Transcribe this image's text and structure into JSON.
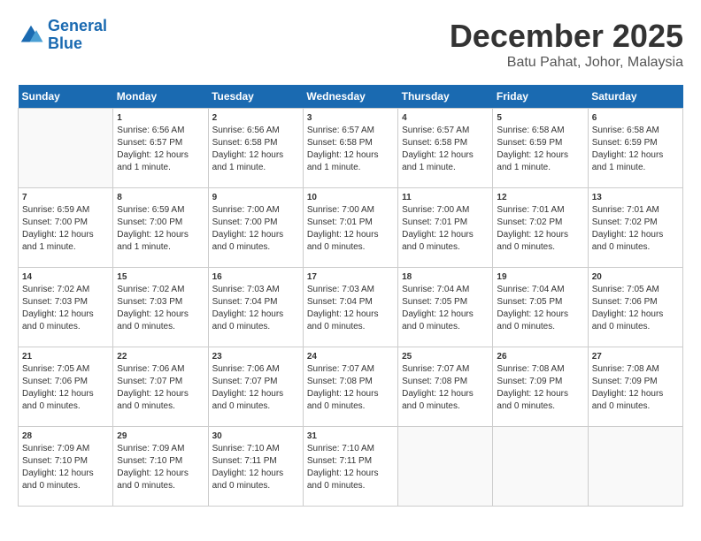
{
  "logo": {
    "line1": "General",
    "line2": "Blue"
  },
  "title": "December 2025",
  "location": "Batu Pahat, Johor, Malaysia",
  "days_of_week": [
    "Sunday",
    "Monday",
    "Tuesday",
    "Wednesday",
    "Thursday",
    "Friday",
    "Saturday"
  ],
  "weeks": [
    [
      {
        "day": "",
        "sunrise": "",
        "sunset": "",
        "daylight": ""
      },
      {
        "day": "1",
        "sunrise": "Sunrise: 6:56 AM",
        "sunset": "Sunset: 6:57 PM",
        "daylight": "Daylight: 12 hours and 1 minute."
      },
      {
        "day": "2",
        "sunrise": "Sunrise: 6:56 AM",
        "sunset": "Sunset: 6:58 PM",
        "daylight": "Daylight: 12 hours and 1 minute."
      },
      {
        "day": "3",
        "sunrise": "Sunrise: 6:57 AM",
        "sunset": "Sunset: 6:58 PM",
        "daylight": "Daylight: 12 hours and 1 minute."
      },
      {
        "day": "4",
        "sunrise": "Sunrise: 6:57 AM",
        "sunset": "Sunset: 6:58 PM",
        "daylight": "Daylight: 12 hours and 1 minute."
      },
      {
        "day": "5",
        "sunrise": "Sunrise: 6:58 AM",
        "sunset": "Sunset: 6:59 PM",
        "daylight": "Daylight: 12 hours and 1 minute."
      },
      {
        "day": "6",
        "sunrise": "Sunrise: 6:58 AM",
        "sunset": "Sunset: 6:59 PM",
        "daylight": "Daylight: 12 hours and 1 minute."
      }
    ],
    [
      {
        "day": "7",
        "sunrise": "Sunrise: 6:59 AM",
        "sunset": "Sunset: 7:00 PM",
        "daylight": "Daylight: 12 hours and 1 minute."
      },
      {
        "day": "8",
        "sunrise": "Sunrise: 6:59 AM",
        "sunset": "Sunset: 7:00 PM",
        "daylight": "Daylight: 12 hours and 1 minute."
      },
      {
        "day": "9",
        "sunrise": "Sunrise: 7:00 AM",
        "sunset": "Sunset: 7:00 PM",
        "daylight": "Daylight: 12 hours and 0 minutes."
      },
      {
        "day": "10",
        "sunrise": "Sunrise: 7:00 AM",
        "sunset": "Sunset: 7:01 PM",
        "daylight": "Daylight: 12 hours and 0 minutes."
      },
      {
        "day": "11",
        "sunrise": "Sunrise: 7:00 AM",
        "sunset": "Sunset: 7:01 PM",
        "daylight": "Daylight: 12 hours and 0 minutes."
      },
      {
        "day": "12",
        "sunrise": "Sunrise: 7:01 AM",
        "sunset": "Sunset: 7:02 PM",
        "daylight": "Daylight: 12 hours and 0 minutes."
      },
      {
        "day": "13",
        "sunrise": "Sunrise: 7:01 AM",
        "sunset": "Sunset: 7:02 PM",
        "daylight": "Daylight: 12 hours and 0 minutes."
      }
    ],
    [
      {
        "day": "14",
        "sunrise": "Sunrise: 7:02 AM",
        "sunset": "Sunset: 7:03 PM",
        "daylight": "Daylight: 12 hours and 0 minutes."
      },
      {
        "day": "15",
        "sunrise": "Sunrise: 7:02 AM",
        "sunset": "Sunset: 7:03 PM",
        "daylight": "Daylight: 12 hours and 0 minutes."
      },
      {
        "day": "16",
        "sunrise": "Sunrise: 7:03 AM",
        "sunset": "Sunset: 7:04 PM",
        "daylight": "Daylight: 12 hours and 0 minutes."
      },
      {
        "day": "17",
        "sunrise": "Sunrise: 7:03 AM",
        "sunset": "Sunset: 7:04 PM",
        "daylight": "Daylight: 12 hours and 0 minutes."
      },
      {
        "day": "18",
        "sunrise": "Sunrise: 7:04 AM",
        "sunset": "Sunset: 7:05 PM",
        "daylight": "Daylight: 12 hours and 0 minutes."
      },
      {
        "day": "19",
        "sunrise": "Sunrise: 7:04 AM",
        "sunset": "Sunset: 7:05 PM",
        "daylight": "Daylight: 12 hours and 0 minutes."
      },
      {
        "day": "20",
        "sunrise": "Sunrise: 7:05 AM",
        "sunset": "Sunset: 7:06 PM",
        "daylight": "Daylight: 12 hours and 0 minutes."
      }
    ],
    [
      {
        "day": "21",
        "sunrise": "Sunrise: 7:05 AM",
        "sunset": "Sunset: 7:06 PM",
        "daylight": "Daylight: 12 hours and 0 minutes."
      },
      {
        "day": "22",
        "sunrise": "Sunrise: 7:06 AM",
        "sunset": "Sunset: 7:07 PM",
        "daylight": "Daylight: 12 hours and 0 minutes."
      },
      {
        "day": "23",
        "sunrise": "Sunrise: 7:06 AM",
        "sunset": "Sunset: 7:07 PM",
        "daylight": "Daylight: 12 hours and 0 minutes."
      },
      {
        "day": "24",
        "sunrise": "Sunrise: 7:07 AM",
        "sunset": "Sunset: 7:08 PM",
        "daylight": "Daylight: 12 hours and 0 minutes."
      },
      {
        "day": "25",
        "sunrise": "Sunrise: 7:07 AM",
        "sunset": "Sunset: 7:08 PM",
        "daylight": "Daylight: 12 hours and 0 minutes."
      },
      {
        "day": "26",
        "sunrise": "Sunrise: 7:08 AM",
        "sunset": "Sunset: 7:09 PM",
        "daylight": "Daylight: 12 hours and 0 minutes."
      },
      {
        "day": "27",
        "sunrise": "Sunrise: 7:08 AM",
        "sunset": "Sunset: 7:09 PM",
        "daylight": "Daylight: 12 hours and 0 minutes."
      }
    ],
    [
      {
        "day": "28",
        "sunrise": "Sunrise: 7:09 AM",
        "sunset": "Sunset: 7:10 PM",
        "daylight": "Daylight: 12 hours and 0 minutes."
      },
      {
        "day": "29",
        "sunrise": "Sunrise: 7:09 AM",
        "sunset": "Sunset: 7:10 PM",
        "daylight": "Daylight: 12 hours and 0 minutes."
      },
      {
        "day": "30",
        "sunrise": "Sunrise: 7:10 AM",
        "sunset": "Sunset: 7:11 PM",
        "daylight": "Daylight: 12 hours and 0 minutes."
      },
      {
        "day": "31",
        "sunrise": "Sunrise: 7:10 AM",
        "sunset": "Sunset: 7:11 PM",
        "daylight": "Daylight: 12 hours and 0 minutes."
      },
      {
        "day": "",
        "sunrise": "",
        "sunset": "",
        "daylight": ""
      },
      {
        "day": "",
        "sunrise": "",
        "sunset": "",
        "daylight": ""
      },
      {
        "day": "",
        "sunrise": "",
        "sunset": "",
        "daylight": ""
      }
    ]
  ]
}
